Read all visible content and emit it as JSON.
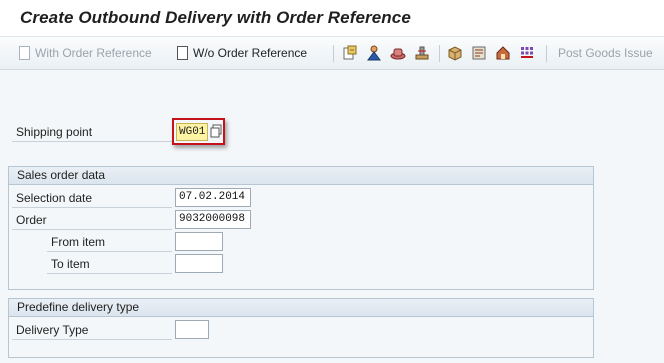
{
  "title": "Create Outbound Delivery with Order Reference",
  "toolbar": {
    "with_order_ref": "With Order Reference",
    "wo_order_ref": "W/o Order Reference",
    "post_goods_issue": "Post Goods Issue",
    "icons": [
      "save-as-icon",
      "user-icon",
      "hat-icon",
      "stamp-icon",
      "box-icon",
      "tool-icon",
      "house-icon",
      "grid-icon"
    ]
  },
  "shipping_point": {
    "label": "Shipping point",
    "value": "WG01"
  },
  "sales_order_data": {
    "header": "Sales order data",
    "selection_date_label": "Selection date",
    "selection_date_value": "07.02.2014",
    "order_label": "Order",
    "order_value": "9032000098",
    "from_item_label": "From item",
    "from_item_value": "",
    "to_item_label": "To item",
    "to_item_value": ""
  },
  "predefine_delivery": {
    "header": "Predefine delivery type",
    "delivery_type_label": "Delivery Type",
    "delivery_type_value": ""
  },
  "colors": {
    "highlight": "#c4141a",
    "required_field": "#fdf3a3"
  }
}
